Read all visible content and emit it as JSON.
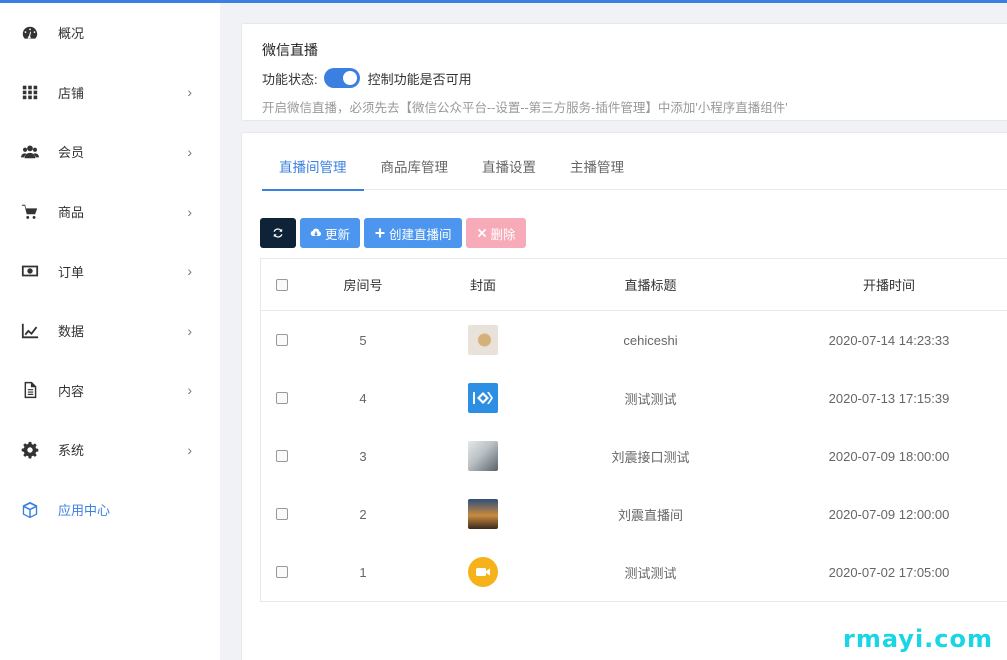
{
  "sidebar": {
    "items": [
      {
        "label": "概况",
        "icon": "dashboard-icon",
        "chevron": ""
      },
      {
        "label": "店铺",
        "icon": "grid-icon",
        "chevron": "›"
      },
      {
        "label": "会员",
        "icon": "users-icon",
        "chevron": "›"
      },
      {
        "label": "商品",
        "icon": "cart-icon",
        "chevron": "›"
      },
      {
        "label": "订单",
        "icon": "money-icon",
        "chevron": "›"
      },
      {
        "label": "数据",
        "icon": "chart-icon",
        "chevron": "›"
      },
      {
        "label": "内容",
        "icon": "document-icon",
        "chevron": "›"
      },
      {
        "label": "系统",
        "icon": "gear-icon",
        "chevron": "›"
      },
      {
        "label": "应用中心",
        "icon": "cube-icon",
        "chevron": "",
        "active": true
      }
    ]
  },
  "header": {
    "title": "微信直播",
    "status_label": "功能状态:",
    "switch_on": true,
    "switch_desc": "控制功能是否可用",
    "hint": "开启微信直播，必须先去【微信公众平台--设置--第三方服务-插件管理】中添加'小程序直播组件'"
  },
  "tabs": [
    "直播间管理",
    "商品库管理",
    "直播设置",
    "主播管理"
  ],
  "toolbar": {
    "update_label": "更新",
    "create_label": "创建直播间",
    "delete_label": "删除"
  },
  "table": {
    "columns": [
      "房间号",
      "封面",
      "直播标题",
      "开播时间"
    ],
    "rows": [
      {
        "room": "5",
        "cover": "photo-thumb",
        "title": "cehiceshi",
        "time": "2020-07-14 14:23:33"
      },
      {
        "room": "4",
        "cover": "logo-thumb",
        "title": "测试测试",
        "time": "2020-07-13 17:15:39"
      },
      {
        "room": "3",
        "cover": "photo-thumb",
        "title": "刘震接口测试",
        "time": "2020-07-09 18:00:00"
      },
      {
        "room": "2",
        "cover": "sunset-thumb",
        "title": "刘震直播间",
        "time": "2020-07-09 12:00:00"
      },
      {
        "room": "1",
        "cover": "camera-thumb",
        "title": "测试测试",
        "time": "2020-07-02 17:05:00"
      }
    ]
  },
  "watermark": "rmayi.com",
  "colors": {
    "accent": "#3b7fe0",
    "dark_button": "#0e2238",
    "blue_button": "#4c96f0",
    "delete_button": "#f7aab8",
    "watermark": "#18d6e6"
  }
}
